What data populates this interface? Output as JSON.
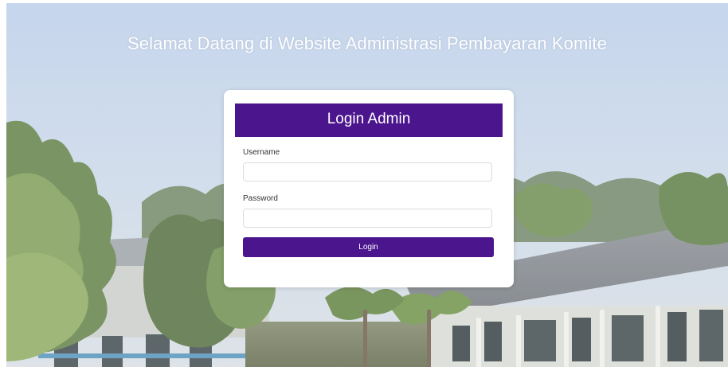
{
  "page": {
    "welcome_text": "Selamat Datang di Website Administrasi Pembayaran Komite"
  },
  "login_card": {
    "title": "Login Admin",
    "username_label": "Username",
    "username_value": "",
    "username_placeholder": "",
    "password_label": "Password",
    "password_value": "",
    "password_placeholder": "",
    "submit_label": "Login"
  },
  "theme": {
    "primary_color": "#4b158d",
    "card_background": "#ffffff",
    "heading_text_color": "#ffffff"
  },
  "background": {
    "description_icon": "school-building-photo"
  }
}
